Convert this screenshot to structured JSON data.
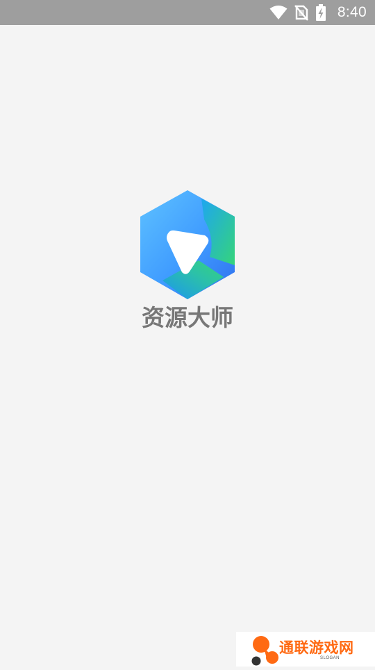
{
  "status_bar": {
    "time": "8:40",
    "icons": [
      "wifi-icon",
      "no-sim-icon",
      "battery-charging-icon"
    ]
  },
  "splash": {
    "app_name": "资源大师",
    "logo_icon": "hexagon-arrow-logo-icon",
    "background_color": "#f4f4f4"
  },
  "watermark": {
    "name": "通联游戏网",
    "slogan": "SLOGAN",
    "accent_color": "#ff6a13"
  }
}
